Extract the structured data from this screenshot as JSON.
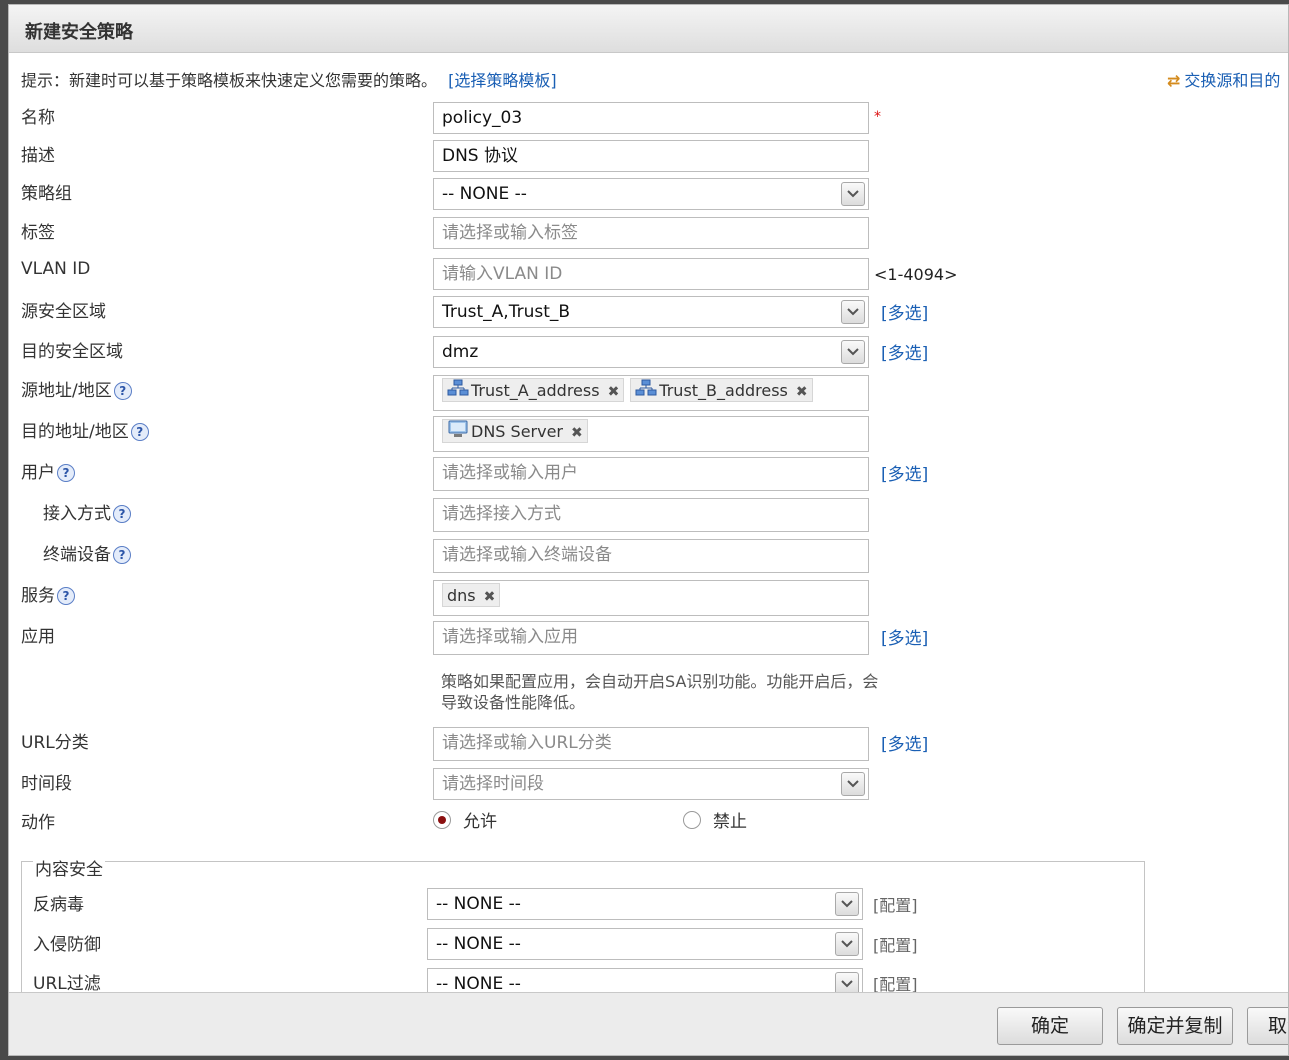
{
  "dialog": {
    "title": "新建安全策略",
    "hint": "提示：新建时可以基于策略模板来快速定义您需要的策略。",
    "template_link": "[选择策略模板]",
    "swap_link": "交换源和目的"
  },
  "form": {
    "name": {
      "label": "名称",
      "value": "policy_03",
      "required_mark": "*"
    },
    "desc": {
      "label": "描述",
      "value": "DNS 协议"
    },
    "group": {
      "label": "策略组",
      "value": "-- NONE --"
    },
    "tags": {
      "label": "标签",
      "placeholder": "请选择或输入标签"
    },
    "vlan": {
      "label": "VLAN ID",
      "placeholder": "请输入VLAN ID",
      "range": "<1-4094>"
    },
    "src_zone": {
      "label": "源安全区域",
      "value": "Trust_A,Trust_B",
      "multi": "[多选]"
    },
    "dst_zone": {
      "label": "目的安全区域",
      "value": "dmz",
      "multi": "[多选]"
    },
    "src_addr": {
      "label": "源地址/地区",
      "tags": [
        "Trust_A_address",
        "Trust_B_address"
      ]
    },
    "dst_addr": {
      "label": "目的地址/地区",
      "tags": [
        "DNS Server"
      ]
    },
    "user": {
      "label": "用户",
      "placeholder": "请选择或输入用户",
      "multi": "[多选]"
    },
    "access": {
      "label": "接入方式",
      "placeholder": "请选择接入方式"
    },
    "terminal": {
      "label": "终端设备",
      "placeholder": "请选择或输入终端设备"
    },
    "service": {
      "label": "服务",
      "tags": [
        "dns"
      ]
    },
    "app": {
      "label": "应用",
      "placeholder": "请选择或输入应用",
      "multi": "[多选]",
      "note": "策略如果配置应用，会自动开启SA识别功能。功能开启后，会导致设备性能降低。"
    },
    "url_cat": {
      "label": "URL分类",
      "placeholder": "请选择或输入URL分类",
      "multi": "[多选]"
    },
    "time": {
      "label": "时间段",
      "placeholder": "请选择时间段"
    },
    "action": {
      "label": "动作",
      "allow": "允许",
      "deny": "禁止",
      "selected": "allow"
    }
  },
  "content_security": {
    "legend": "内容安全",
    "antivirus": {
      "label": "反病毒",
      "value": "-- NONE --",
      "config": "[配置]"
    },
    "ips": {
      "label": "入侵防御",
      "value": "-- NONE --",
      "config": "[配置]"
    },
    "url_filter": {
      "label": "URL过滤",
      "value": "-- NONE --",
      "config": "[配置]"
    }
  },
  "buttons": {
    "ok": "确定",
    "ok_copy": "确定并复制",
    "cancel": "取消"
  },
  "icons": {
    "help": "?",
    "remove": "✖"
  }
}
